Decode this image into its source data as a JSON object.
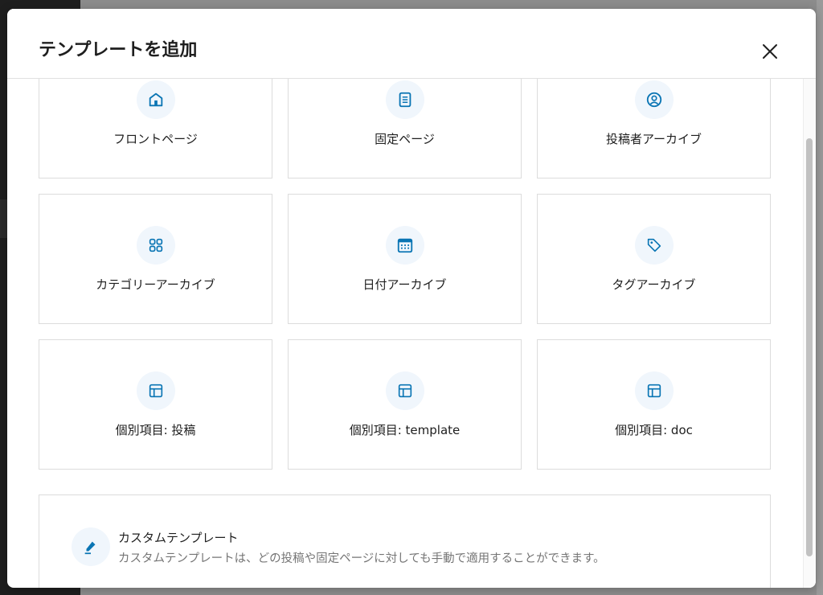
{
  "modal": {
    "title": "テンプレートを追加",
    "close_icon": "close-icon"
  },
  "templates": [
    {
      "label": "フロントページ",
      "icon": "home-icon"
    },
    {
      "label": "固定ページ",
      "icon": "page-icon"
    },
    {
      "label": "投稿者アーカイブ",
      "icon": "user-icon"
    },
    {
      "label": "カテゴリーアーカイブ",
      "icon": "category-icon"
    },
    {
      "label": "日付アーカイブ",
      "icon": "calendar-icon"
    },
    {
      "label": "タグアーカイブ",
      "icon": "tag-icon"
    },
    {
      "label": "個別項目: 投稿",
      "icon": "layout-icon"
    },
    {
      "label": "個別項目: template",
      "icon": "layout-icon"
    },
    {
      "label": "個別項目: doc",
      "icon": "layout-icon"
    }
  ],
  "custom": {
    "title": "カスタムテンプレート",
    "description": "カスタムテンプレートは、どの投稿や固定ページに対しても手動で適用することができます。",
    "icon": "pencil-icon"
  },
  "colors": {
    "accent": "#0a75b4",
    "icon_bg": "#f0f6fc"
  }
}
